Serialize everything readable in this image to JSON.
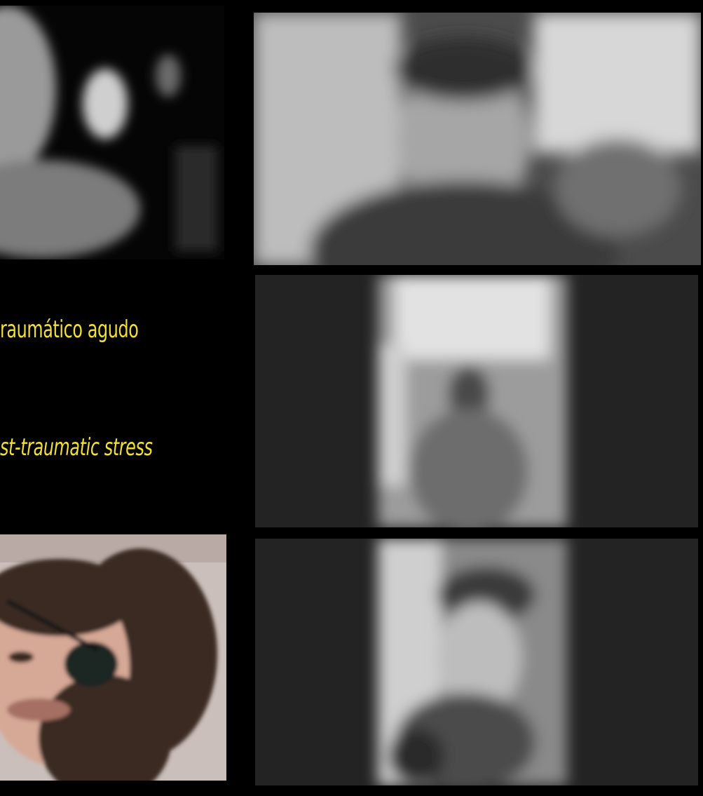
{
  "captions": {
    "line1": "raumático agudo",
    "line2": "st-traumatic stress"
  },
  "colors": {
    "background": "#000000",
    "caption": "#f3df3a"
  },
  "participants": [
    {
      "id": "participant-top-left",
      "mode": "grayscale"
    },
    {
      "id": "participant-top-right",
      "mode": "grayscale"
    },
    {
      "id": "participant-middle-right",
      "mode": "grayscale"
    },
    {
      "id": "participant-bottom-right",
      "mode": "grayscale"
    },
    {
      "id": "participant-bottom-left",
      "mode": "color"
    }
  ]
}
